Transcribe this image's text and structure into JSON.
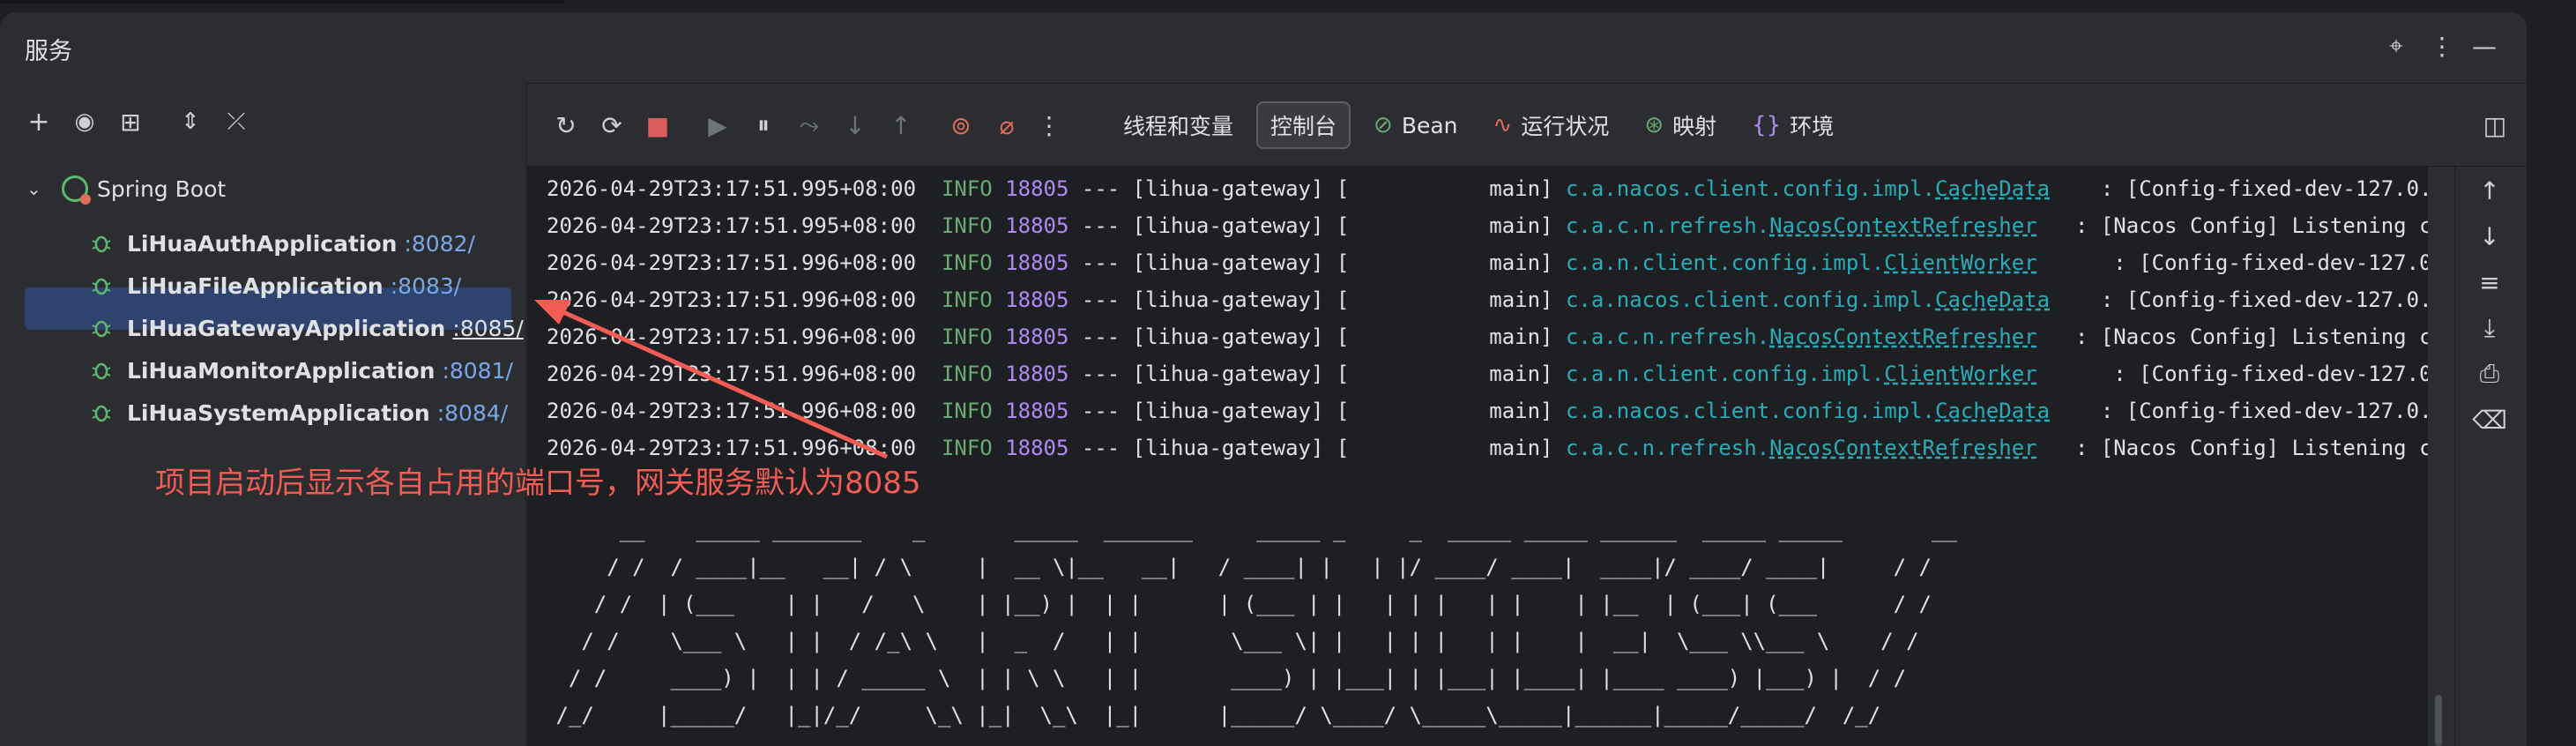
{
  "panel": {
    "title": "服务",
    "icons": [
      "crosshair-icon",
      "more-vertical-icon",
      "minimize-icon"
    ]
  },
  "left_toolbar": {
    "icons": [
      "add-icon",
      "eye-icon",
      "new-tab-icon",
      "expand-all-icon",
      "collapse-all-icon"
    ],
    "glyphs": [
      "+",
      "👁",
      "⧉",
      "⌃",
      "⨯"
    ]
  },
  "tree": {
    "root_label": "Spring Boot",
    "apps": [
      {
        "name": "LiHuaAuthApplication",
        "port": ":8082/"
      },
      {
        "name": "LiHuaFileApplication",
        "port": ":8083/"
      },
      {
        "name": "LiHuaGatewayApplication",
        "port": ":8085/",
        "selected": true
      },
      {
        "name": "LiHuaMonitorApplication",
        "port": ":8081/"
      },
      {
        "name": "LiHuaSystemApplication",
        "port": ":8084/"
      }
    ]
  },
  "console_toolbar": {
    "glyphs": [
      "↻",
      "⟳",
      "■",
      "▶",
      "⏸",
      "⤳",
      "↓",
      "↑",
      "⊘",
      "⌀",
      "⋮"
    ],
    "tabs": [
      {
        "label": "线程和变量",
        "icon": ""
      },
      {
        "label": "控制台",
        "icon": "",
        "active": true
      },
      {
        "label": "Bean",
        "icon": "⊘"
      },
      {
        "label": "运行状况",
        "icon": "∿"
      },
      {
        "label": "映射",
        "icon": "⊛"
      },
      {
        "label": "环境",
        "icon": "{}"
      }
    ]
  },
  "log_lines": [
    {
      "ts": "2026-04-29T23:17:51.995+08:00",
      "level": "INFO",
      "pid": "18805",
      "mid": " --- [lihua-gateway] [           main] ",
      "lpre": "c.a.nacos.client.config.impl.",
      "lcls": "CacheData",
      "msg": "    : [Config-fixed-dev-127.0.0."
    },
    {
      "ts": "2026-04-29T23:17:51.995+08:00",
      "level": "INFO",
      "pid": "18805",
      "mid": " --- [lihua-gateway] [           main] ",
      "lpre": "c.a.c.n.refresh.",
      "lcls": "NacosContextRefresher",
      "msg": "   : [Nacos Config] Listening c"
    },
    {
      "ts": "2026-04-29T23:17:51.996+08:00",
      "level": "INFO",
      "pid": "18805",
      "mid": " --- [lihua-gateway] [           main] ",
      "lpre": "c.a.n.client.config.impl.",
      "lcls": "ClientWorker",
      "msg": "      : [Config-fixed-dev-127.0.0."
    },
    {
      "ts": "2026-04-29T23:17:51.996+08:00",
      "level": "INFO",
      "pid": "18805",
      "mid": " --- [lihua-gateway] [           main] ",
      "lpre": "c.a.nacos.client.config.impl.",
      "lcls": "CacheData",
      "msg": "    : [Config-fixed-dev-127.0.0."
    },
    {
      "ts": "2026-04-29T23:17:51.996+08:00",
      "level": "INFO",
      "pid": "18805",
      "mid": " --- [lihua-gateway] [           main] ",
      "lpre": "c.a.c.n.refresh.",
      "lcls": "NacosContextRefresher",
      "msg": "   : [Nacos Config] Listening c"
    },
    {
      "ts": "2026-04-29T23:17:51.996+08:00",
      "level": "INFO",
      "pid": "18805",
      "mid": " --- [lihua-gateway] [           main] ",
      "lpre": "c.a.n.client.config.impl.",
      "lcls": "ClientWorker",
      "msg": "      : [Config-fixed-dev-127.0.0."
    },
    {
      "ts": "2026-04-29T23:17:51.996+08:00",
      "level": "INFO",
      "pid": "18805",
      "mid": " --- [lihua-gateway] [           main] ",
      "lpre": "c.a.nacos.client.config.impl.",
      "lcls": "CacheData",
      "msg": "    : [Config-fixed-dev-127.0.0."
    },
    {
      "ts": "2026-04-29T23:17:51.996+08:00",
      "level": "INFO",
      "pid": "18805",
      "mid": " --- [lihua-gateway] [           main] ",
      "lpre": "c.a.c.n.refresh.",
      "lcls": "NacosContextRefresher",
      "msg": "   : [Nacos Config] Listening c"
    }
  ],
  "banner": "      __    _____ _______    _       _____  _______     _____ _     _  _____ _____ ______  _____ _____       __\n     / /  / ____|__   __| / \\     |  __ \\|__   __|   / ____| |   | |/ ____/ ____|  ____|/ ____/ ____|     / /\n    / /  | (___    | |   /   \\    | |__) |  | |      | (___ | |   | | |   | |    | |__  | (___| (___      / /\n   / /    \\___ \\   | |  / /_\\ \\   |  _  /   | |       \\___ \\| |   | | |   | |    |  __|  \\___ \\\\___ \\    / /\n  / /     ____) |  | | / _____ \\  | | \\ \\   | |       ____) | |___| | |___| |____| |____ ____) |___) |  / /\n /_/     |_____/   |_|/_/     \\_\\ |_|  \\_\\  |_|      |_____/ \\____/ \\_____\\_____|______|_____/_____/  /_/",
  "right_toolbar": {
    "icons": [
      "scroll-up-icon",
      "scroll-down-icon",
      "soft-wrap-icon",
      "scroll-to-end-icon",
      "print-icon",
      "trash-icon"
    ],
    "glyphs": [
      "↑",
      "↓",
      "⤶",
      "⤓",
      "⎙",
      "🗑"
    ]
  },
  "annotation": {
    "text": "项目启动后显示各自占用的端口号，网关服务默认为8085",
    "color": "#f25c54"
  }
}
